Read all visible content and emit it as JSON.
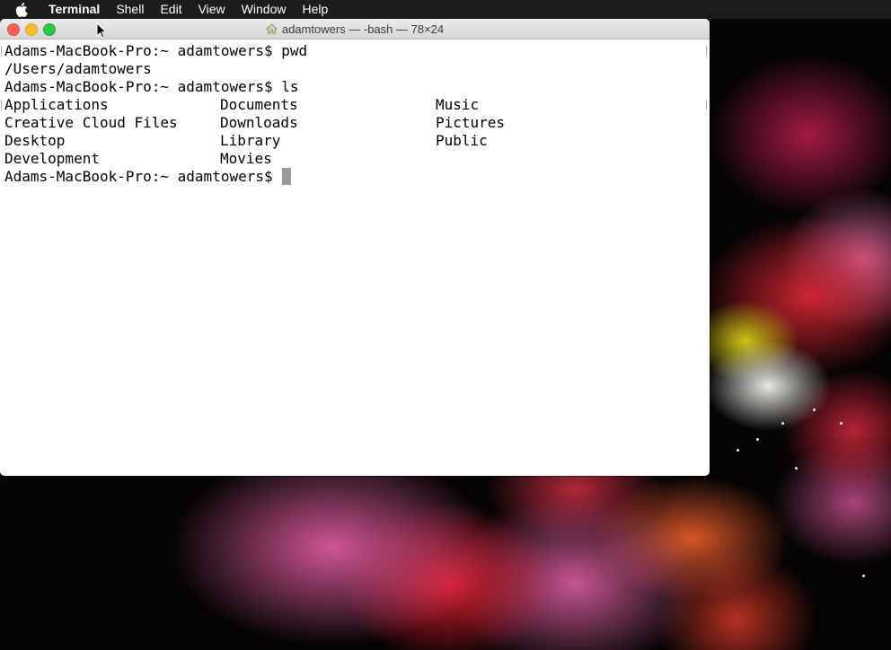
{
  "menubar": {
    "app_name": "Terminal",
    "items": [
      "Shell",
      "Edit",
      "View",
      "Window",
      "Help"
    ]
  },
  "window": {
    "title": "adamtowers — -bash — 78×24",
    "title_icon": "home-folder-icon"
  },
  "terminal": {
    "prompt": "Adams-MacBook-Pro:~ adamtowers$",
    "cmd1": "pwd",
    "cmd1_output": "/Users/adamtowers",
    "cmd2": "ls",
    "ls_rows": [
      [
        "Applications",
        "Documents",
        "Music"
      ],
      [
        "Creative Cloud Files",
        "Downloads",
        "Pictures"
      ],
      [
        "Desktop",
        "Library",
        "Public"
      ],
      [
        "Development",
        "Movies",
        ""
      ]
    ]
  },
  "colors": {
    "close": "#fc5f57",
    "minimize": "#fdbc2e",
    "zoom": "#28c840",
    "cursor": "#9a9a9a"
  }
}
